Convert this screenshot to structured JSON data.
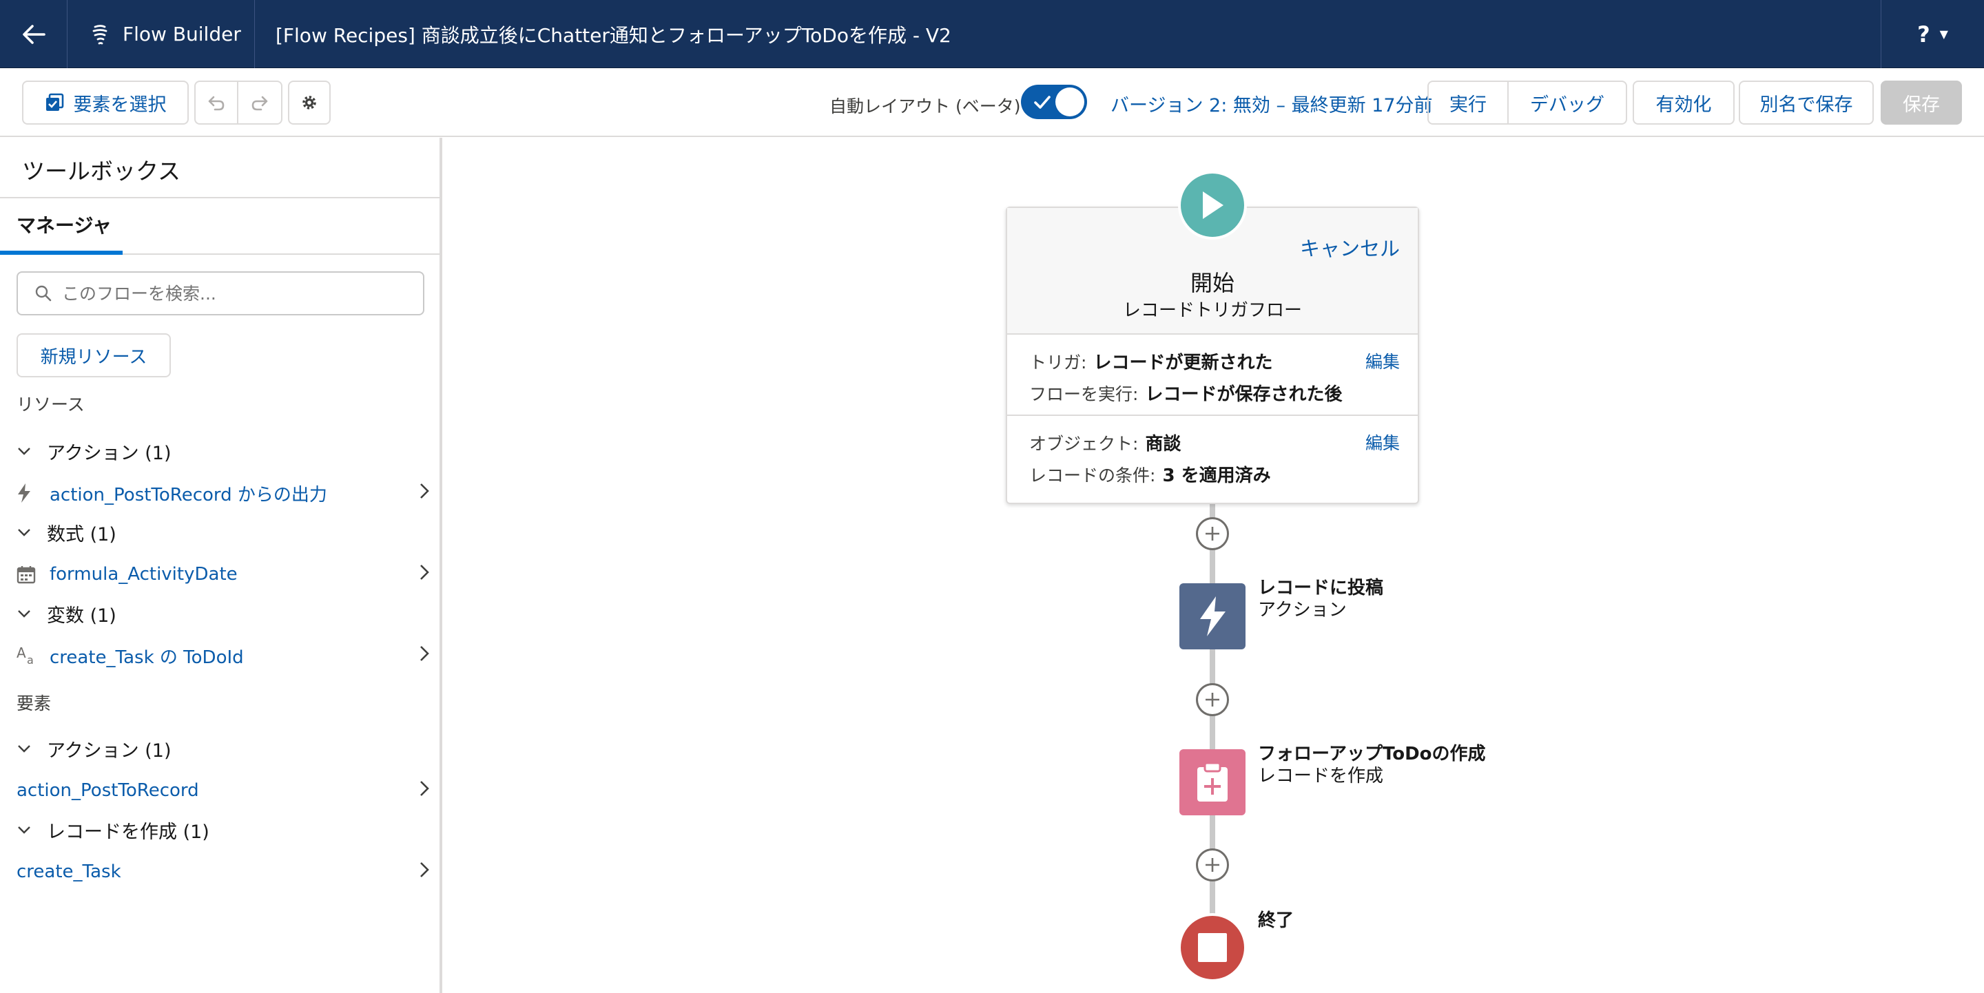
{
  "header": {
    "back_icon": "arrow-left-icon",
    "app_icon": "flow-icon",
    "app_name": "Flow Builder",
    "flow_title": "[Flow Recipes] 商談成立後にChatter通知とフォローアップToDoを作成 - V2",
    "help_label": "?"
  },
  "toolbar": {
    "select_elements_label": "要素を選択",
    "auto_layout_label": "自動レイアウト (ベータ)",
    "auto_layout_on": true,
    "version_status": "バージョン 2: 無効 – 最終更新 17分前",
    "run_label": "実行",
    "debug_label": "デバッグ",
    "activate_label": "有効化",
    "save_as_label": "別名で保存",
    "save_label": "保存"
  },
  "toolbox": {
    "title": "ツールボックス",
    "tab_manager": "マネージャ",
    "search_placeholder": "このフローを検索...",
    "new_resource_label": "新規リソース",
    "resources_heading": "リソース",
    "elements_heading": "要素",
    "resource_groups": [
      {
        "label": "アクション (1)",
        "item": "action_PostToRecord からの出力",
        "icon": "lightning-icon"
      },
      {
        "label": "数式 (1)",
        "item": "formula_ActivityDate",
        "icon": "calendar-icon"
      },
      {
        "label": "変数 (1)",
        "item": "create_Task の ToDoId",
        "icon": "text-variable-icon"
      }
    ],
    "element_groups": [
      {
        "label": "アクション (1)",
        "item": "action_PostToRecord"
      },
      {
        "label": "レコードを作成 (1)",
        "item": "create_Task"
      }
    ]
  },
  "canvas": {
    "start": {
      "cancel_label": "キャンセル",
      "title": "開始",
      "subtitle": "レコードトリガフロー",
      "trigger_label": "トリガ:",
      "trigger_value": "レコードが更新された",
      "run_label": "フローを実行:",
      "run_value": "レコードが保存された後",
      "object_label": "オブジェクト:",
      "object_value": "商談",
      "conditions_label": "レコードの条件:",
      "conditions_value": "3 を適用済み",
      "edit_label": "編集"
    },
    "nodes": [
      {
        "name": "レコードに投稿",
        "type": "アクション",
        "color": "#54698d"
      },
      {
        "name": "フォローアップToDoの作成",
        "type": "レコードを作成",
        "color": "#e07491"
      }
    ],
    "end_label": "終了",
    "colors": {
      "start": "#5bb5b0",
      "end": "#c94a44",
      "accent": "#0b5cab",
      "header_bg": "#16325c"
    }
  }
}
